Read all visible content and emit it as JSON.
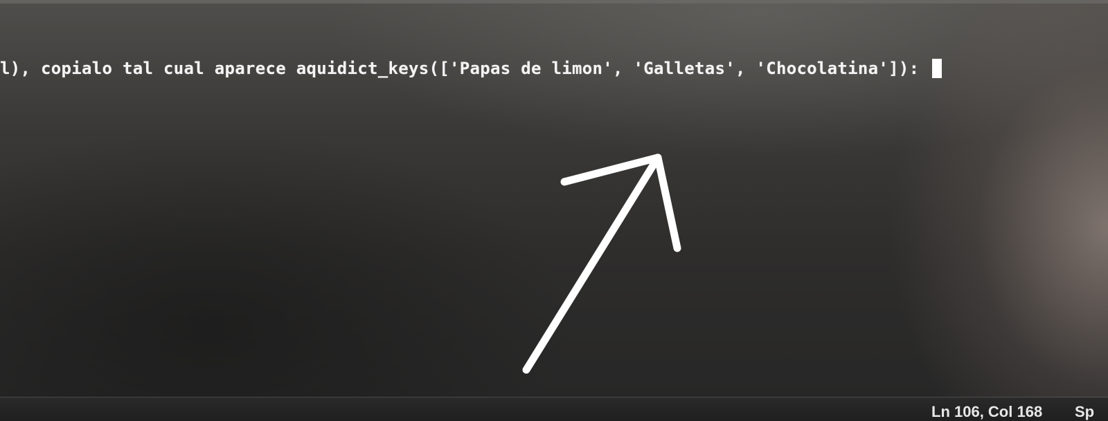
{
  "terminal": {
    "line_text": "l), copialo tal cual aparece aquidict_keys(['Papas de limon', 'Galletas', 'Chocolatina']): "
  },
  "status_bar": {
    "position": "Ln 106, Col 168",
    "extra": "Sp"
  },
  "colors": {
    "background": "#2b2a29",
    "text": "#f4f4f4",
    "arrow": "#ffffff"
  },
  "icons": {
    "annotation": "arrow-up-right-icon",
    "cursor": "block-cursor"
  }
}
